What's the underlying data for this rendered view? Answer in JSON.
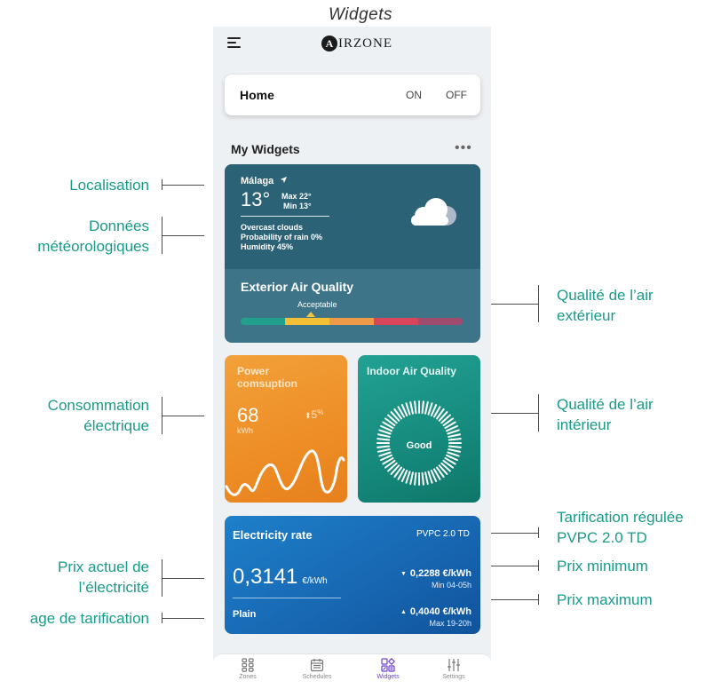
{
  "page_title": "Widgets",
  "app": {
    "logo_initial": "A",
    "logo_text": "IRZONE"
  },
  "home": {
    "label": "Home",
    "on": "ON",
    "off": "OFF"
  },
  "widgets": {
    "title": "My Widgets",
    "more": "•••"
  },
  "weather": {
    "city": "Málaga",
    "temperature": "13°",
    "max": "Max 22°",
    "min": "Min 13°",
    "condition": "Overcast clouds",
    "rain": "Probability of rain 0%",
    "humidity": "Humidity 45%",
    "air_quality_title": "Exterior Air Quality",
    "air_quality_value": "Acceptable",
    "air_quality_scale_colors": [
      "#22a08e",
      "#f3bf34",
      "#ef9a48",
      "#d9455a",
      "#9f4c6e"
    ]
  },
  "power": {
    "title": "Power comsuption",
    "value": "68",
    "unit": "kWh",
    "delta": "5",
    "delta_unit": "%"
  },
  "indoor_air": {
    "title": "Indoor Air Quality",
    "status": "Good"
  },
  "electricity": {
    "title": "Electricity rate",
    "tariff": "PVPC 2.0 TD",
    "price": "0,3141",
    "price_unit": "€/kWh",
    "plan": "Plain",
    "min_price": "0,2288 €/kWh",
    "min_time": "Min 04-05h",
    "max_price": "0,4040 €/kWh",
    "max_time": "Max 19-20h"
  },
  "tabs": [
    {
      "label": "Zones",
      "icon": "grid-icon"
    },
    {
      "label": "Schedules",
      "icon": "calendar-icon"
    },
    {
      "label": "Widgets",
      "icon": "widgets-icon",
      "active": true
    },
    {
      "label": "Settings",
      "icon": "sliders-icon"
    }
  ],
  "callouts": {
    "localisation": "Localisation",
    "meteo_1": "Données",
    "meteo_2": "météorologiques",
    "exterior_air_1": "Qualité de l’air",
    "exterior_air_2": "extérieur",
    "consumption_1": "Consommation",
    "consumption_2": "électrique",
    "interior_air_1": "Qualité de l’air",
    "interior_air_2": "intérieur",
    "tariff_1": "Tarification régulée",
    "tariff_2": "PVPC 2.0 TD",
    "current_price_1": "Prix actuel de",
    "current_price_2": "l’électricité",
    "min_price": "Prix minimum",
    "max_price": "Prix maximum",
    "tariff_plan": "age de tarification"
  },
  "colors": {
    "accent_teal": "#1a9a88",
    "active_tab": "#6a3fd0"
  }
}
